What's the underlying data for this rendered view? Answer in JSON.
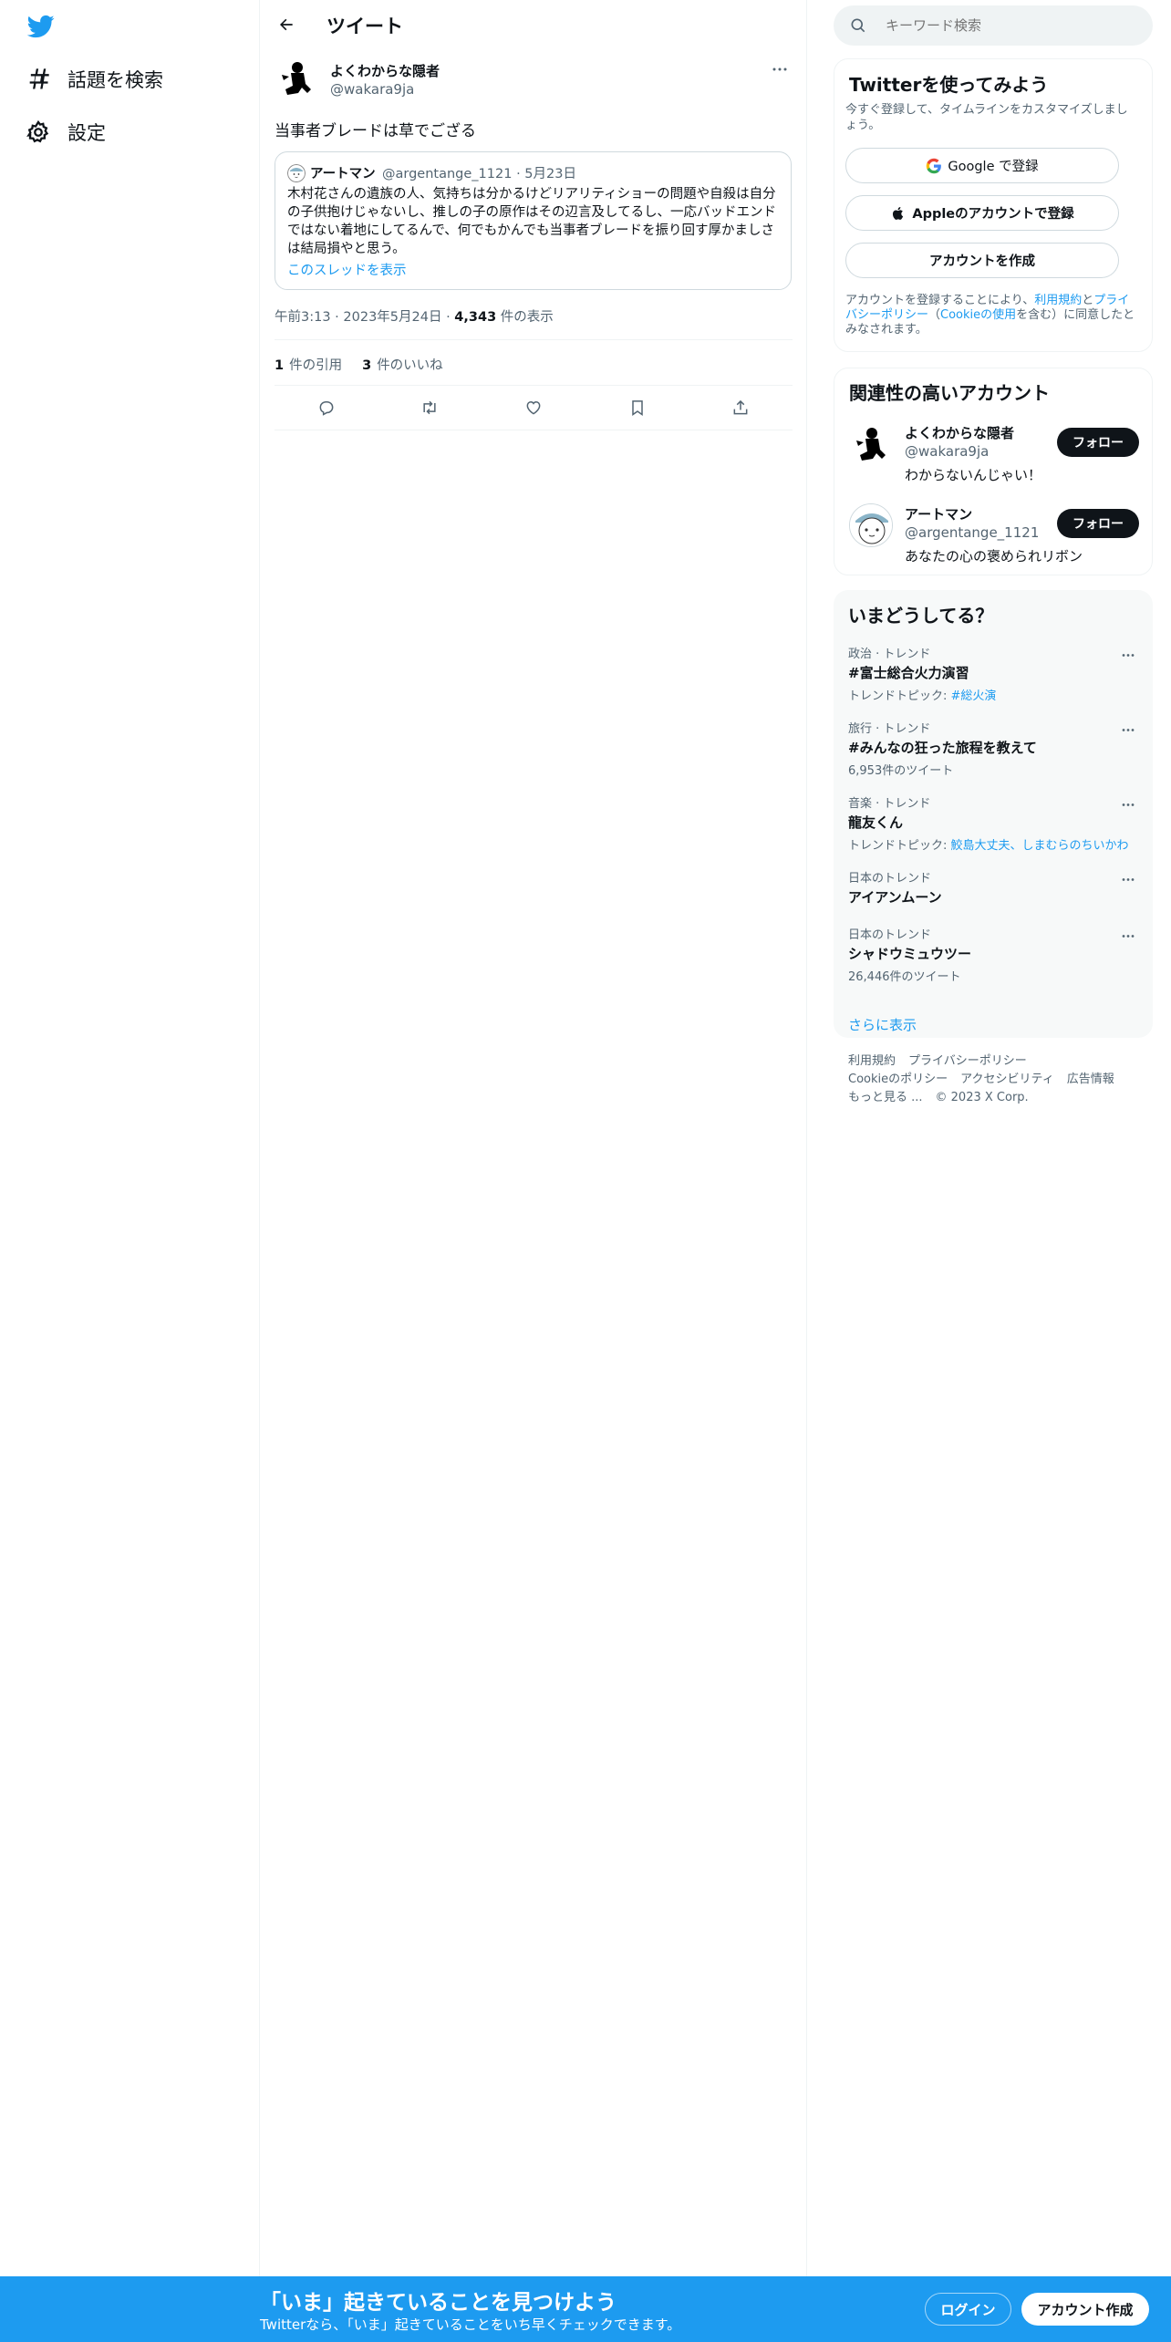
{
  "nav": {
    "logo_icon": "twitter-bird-icon",
    "items": [
      {
        "label": "話題を検索",
        "icon": "hashtag-icon"
      },
      {
        "label": "設定",
        "icon": "gear-icon"
      }
    ]
  },
  "header": {
    "title": "ツイート"
  },
  "tweet": {
    "author_name": "よくわからな隠者",
    "author_handle": "@wakara9ja",
    "text": "当事者ブレードは草でござる",
    "quote": {
      "author_name": "アートマン",
      "author_handle": "@argentange_1121",
      "date": "5月23日",
      "separator": "·",
      "body": "木村花さんの遺族の人、気持ちは分かるけどリアリティショーの問題や自殺は自分の子供抱けじゃないし、推しの子の原作はその辺言及してるし、一応バッドエンドではない着地にしてるんで、何でもかんでも当事者ブレードを振り回す厚かましさは結局損やと思う。",
      "thread_link": "このスレッドを表示"
    },
    "time": "午前3:13",
    "date": "2023年5月24日",
    "views_count": "4,343",
    "views_label": "件の表示",
    "quotes_count": "1",
    "quotes_label": "件の引用",
    "likes_count": "3",
    "likes_label": "件のいいね"
  },
  "search": {
    "placeholder": "キーワード検索"
  },
  "signup": {
    "title": "Twitterを使ってみよう",
    "subtitle": "今すぐ登録して、タイムラインをカスタマイズしましょう。",
    "google_button": "Google で登録",
    "apple_button": "Appleのアカウントで登録",
    "create_button": "アカウントを作成",
    "legal_prefix": "アカウントを登録することにより、",
    "legal_link1": "利用規約",
    "legal_and": "と",
    "legal_link2": "プライバシーポリシー",
    "legal_paren_open": "（",
    "legal_link3": "Cookieの使用",
    "legal_suffix": "を含む）に同意したとみなされます。"
  },
  "related": {
    "title": "関連性の高いアカウント",
    "accounts": [
      {
        "name": "よくわからな隠者",
        "handle": "@wakara9ja",
        "bio": "わからないんじゃい！",
        "follow": "フォロー"
      },
      {
        "name": "アートマン",
        "handle": "@argentange_1121",
        "bio": "あなたの心の褒められリボン",
        "follow": "フォロー"
      }
    ]
  },
  "trends": {
    "title": "いまどうしてる？",
    "items": [
      {
        "category": "政治 · トレンド",
        "title": "#富士総合火力演習",
        "sub_prefix": "トレンドトピック: ",
        "sub_link": "#総火演"
      },
      {
        "category": "旅行 · トレンド",
        "title": "#みんなの狂った旅程を教えて",
        "sub_prefix": "6,953件のツイート",
        "sub_link": ""
      },
      {
        "category": "音楽 · トレンド",
        "title": "龍友くん",
        "sub_prefix": "トレンドトピック: ",
        "sub_link": "鮫島大丈夫、しまむらのちいかわ"
      },
      {
        "category": "日本のトレンド",
        "title": "アイアンムーン",
        "sub_prefix": "",
        "sub_link": ""
      },
      {
        "category": "日本のトレンド",
        "title": "シャドウミュウツー",
        "sub_prefix": "26,446件のツイート",
        "sub_link": ""
      }
    ],
    "show_more": "さらに表示"
  },
  "footer": {
    "links": [
      "利用規約",
      "プライバシーポリシー",
      "Cookieのポリシー",
      "アクセシビリティ",
      "広告情報",
      "もっと見る ...",
      "© 2023 X Corp."
    ]
  },
  "bottom_bar": {
    "title": "「いま」起きていることを見つけよう",
    "subtitle": "Twitterなら、「いま」起きていることをいち早くチェックできます。",
    "login": "ログイン",
    "signup": "アカウント作成"
  },
  "colors": {
    "accent": "#1d9bf0",
    "text": "#0f1419",
    "muted": "#536471",
    "border": "#eff3f4"
  }
}
